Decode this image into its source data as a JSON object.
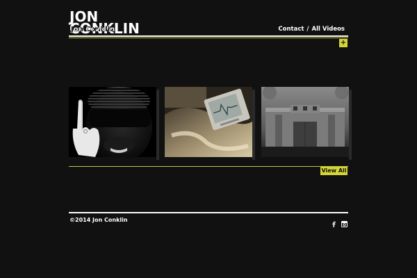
{
  "header": {
    "logo_line1": "JON",
    "logo_line2": "CONKLIN",
    "logo_overlap": "Jon Conklin",
    "nav": [
      {
        "label": "Contact"
      },
      {
        "label": "All Videos"
      }
    ],
    "nav_separator": "/",
    "expand_label": "+"
  },
  "videos": [
    {
      "subject": "man in sunglasses raising finger"
    },
    {
      "subject": "old television monitor on bed"
    },
    {
      "subject": "grey building facade"
    }
  ],
  "view_all_label": "View All",
  "footer": {
    "copyright": "©2014 Jon Conklin",
    "social": [
      {
        "icon": "facebook-icon"
      },
      {
        "icon": "instagram-icon"
      }
    ]
  },
  "colors": {
    "background": "#111111",
    "accent": "#d4d537",
    "rule": "#ffffff"
  }
}
